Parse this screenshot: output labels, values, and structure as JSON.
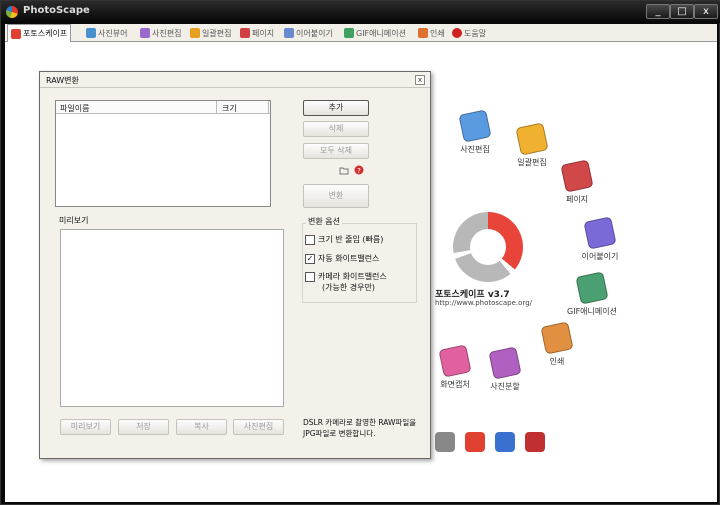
{
  "window": {
    "title": "PhotoScape",
    "min": "_",
    "max": "□",
    "close": "x"
  },
  "tabs": [
    {
      "label": "포토스케이프",
      "color": "#e04030",
      "active": true
    },
    {
      "label": "사진뷰어",
      "color": "#4a8fd0",
      "active": false
    },
    {
      "label": "사진편집",
      "color": "#9a6acd",
      "active": false
    },
    {
      "label": "일괄편집",
      "color": "#e8a020",
      "active": false
    },
    {
      "label": "페이지",
      "color": "#d04040",
      "active": false
    },
    {
      "label": "이어붙이기",
      "color": "#6a8ad0",
      "active": false
    },
    {
      "label": "GIF애니메이션",
      "color": "#40a060",
      "active": false
    },
    {
      "label": "인쇄",
      "color": "#e07030",
      "active": false
    },
    {
      "label": "도움말",
      "color": "#d02020",
      "active": false
    }
  ],
  "home": {
    "items": [
      {
        "label": "사진편집",
        "color": "#5a9ae0"
      },
      {
        "label": "일괄편집",
        "color": "#f0b030"
      },
      {
        "label": "페이지",
        "color": "#d04848"
      },
      {
        "label": "이어붙이기",
        "color": "#7a6ad8"
      },
      {
        "label": "GIF애니메이션",
        "color": "#4aa070"
      },
      {
        "label": "인쇄",
        "color": "#e09040"
      },
      {
        "label": "사진분할",
        "color": "#b060c0"
      },
      {
        "label": "화면캡처",
        "color": "#e060a0"
      }
    ],
    "logo_name": "포토스케이프 v3.7",
    "logo_url": "http://www.photoscape.org/"
  },
  "dialog": {
    "title": "RAW변환",
    "close": "x",
    "filelist_col_name": "파일이름",
    "filelist_col_size": "크기",
    "btn_add": "추가",
    "btn_delete": "삭제",
    "btn_delete_all": "모두 삭제",
    "btn_convert": "변환",
    "preview_label": "미리보기",
    "options_title": "변환 옵션",
    "opt_half_size": "크기 반 줄임 (빠름)",
    "opt_half_size_checked": false,
    "opt_auto_wb": "자동 화이트밸런스",
    "opt_auto_wb_checked": true,
    "opt_camera_wb": "카메라 화이트밸런스",
    "opt_camera_wb_note": "(가능한 경우만)",
    "opt_camera_wb_checked": false,
    "btn_preview": "미리보기",
    "btn_save": "저장",
    "btn_copy": "복사",
    "btn_photo_edit": "사진편집",
    "description": "DSLR 카메라로 촬영한 RAW파일을 JPG파일로 변환합니다."
  }
}
